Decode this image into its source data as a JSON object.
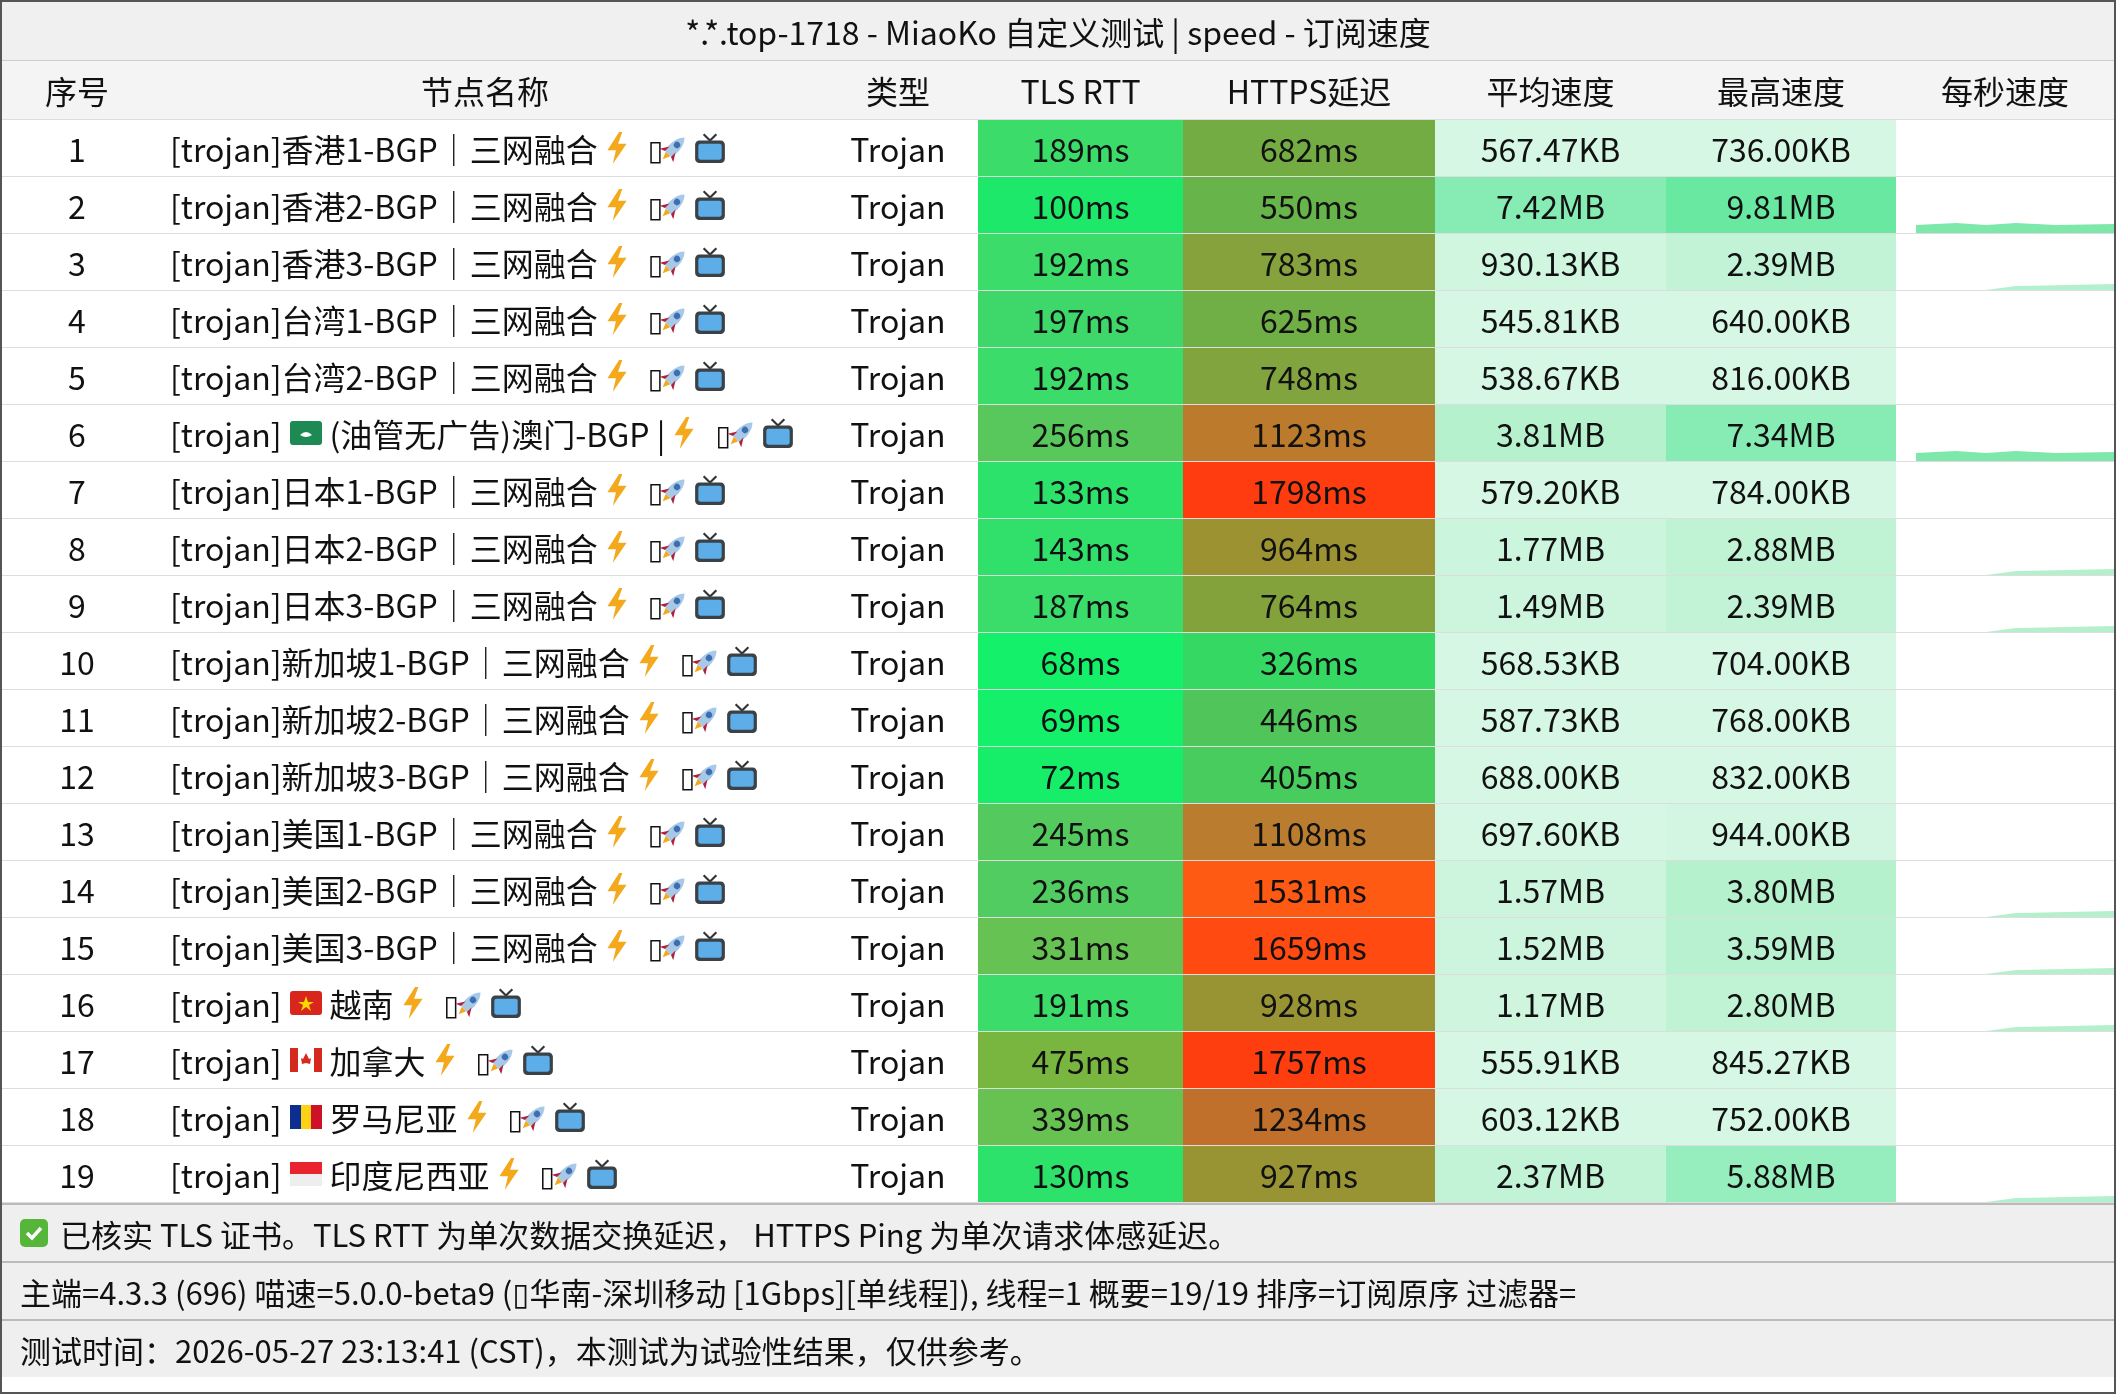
{
  "window": {
    "title": "*.*.top-1718 - MiaoKo 自定义测试 | speed - 订阅速度"
  },
  "columns": [
    "序号",
    "节点名称",
    "类型",
    "TLS RTT",
    "HTTPS延迟",
    "平均速度",
    "最高速度",
    "每秒速度"
  ],
  "rows": [
    {
      "index": "1",
      "name": [
        {
          "kind": "text",
          "text": "[trojan]香港1-BGP｜三网融合"
        },
        {
          "kind": "bolt"
        },
        {
          "kind": "text",
          "text": "▯"
        },
        {
          "kind": "rocket"
        },
        {
          "kind": "tv"
        }
      ],
      "type": "Trojan",
      "tls_rtt": {
        "text": "189ms",
        "color": "#3cdc6a"
      },
      "https_delay": {
        "text": "682ms",
        "color": "#74ac44"
      },
      "avg_speed": {
        "text": "567.47KB",
        "color": "#d6f7e4"
      },
      "max_speed": {
        "text": "736.00KB",
        "color": "#d6f7e4"
      }
    },
    {
      "index": "2",
      "name": [
        {
          "kind": "text",
          "text": "[trojan]香港2-BGP｜三网融合"
        },
        {
          "kind": "bolt"
        },
        {
          "kind": "text",
          "text": "▯"
        },
        {
          "kind": "rocket"
        },
        {
          "kind": "tv"
        }
      ],
      "type": "Trojan",
      "tls_rtt": {
        "text": "100ms",
        "color": "#1ee86a"
      },
      "https_delay": {
        "text": "550ms",
        "color": "#66b44a"
      },
      "avg_speed": {
        "text": "7.42MB",
        "color": "#86ecb4"
      },
      "max_speed": {
        "text": "9.81MB",
        "color": "#68e8a0"
      },
      "sparkline": {
        "kind": "strong"
      }
    },
    {
      "index": "3",
      "name": [
        {
          "kind": "text",
          "text": "[trojan]香港3-BGP｜三网融合"
        },
        {
          "kind": "bolt"
        },
        {
          "kind": "text",
          "text": "▯"
        },
        {
          "kind": "rocket"
        },
        {
          "kind": "tv"
        }
      ],
      "type": "Trojan",
      "tls_rtt": {
        "text": "192ms",
        "color": "#3cdc6a"
      },
      "https_delay": {
        "text": "783ms",
        "color": "#86a23c"
      },
      "avg_speed": {
        "text": "930.13KB",
        "color": "#d0f6e0"
      },
      "max_speed": {
        "text": "2.39MB",
        "color": "#c2f3d6"
      },
      "sparkline": {
        "kind": "faint"
      }
    },
    {
      "index": "4",
      "name": [
        {
          "kind": "text",
          "text": "[trojan]台湾1-BGP｜三网融合"
        },
        {
          "kind": "bolt"
        },
        {
          "kind": "text",
          "text": "▯"
        },
        {
          "kind": "rocket"
        },
        {
          "kind": "tv"
        }
      ],
      "type": "Trojan",
      "tls_rtt": {
        "text": "197ms",
        "color": "#3ed86a"
      },
      "https_delay": {
        "text": "625ms",
        "color": "#70ae46"
      },
      "avg_speed": {
        "text": "545.81KB",
        "color": "#d6f7e4"
      },
      "max_speed": {
        "text": "640.00KB",
        "color": "#d6f7e4"
      }
    },
    {
      "index": "5",
      "name": [
        {
          "kind": "text",
          "text": "[trojan]台湾2-BGP｜三网融合"
        },
        {
          "kind": "bolt"
        },
        {
          "kind": "text",
          "text": "▯"
        },
        {
          "kind": "rocket"
        },
        {
          "kind": "tv"
        }
      ],
      "type": "Trojan",
      "tls_rtt": {
        "text": "192ms",
        "color": "#3cdc6a"
      },
      "https_delay": {
        "text": "748ms",
        "color": "#82a43e"
      },
      "avg_speed": {
        "text": "538.67KB",
        "color": "#d6f7e4"
      },
      "max_speed": {
        "text": "816.00KB",
        "color": "#d6f7e4"
      }
    },
    {
      "index": "6",
      "name": [
        {
          "kind": "text",
          "text": "[trojan]"
        },
        {
          "kind": "flag_mo"
        },
        {
          "kind": "text",
          "text": "(油管无广告)澳门-BGP |"
        },
        {
          "kind": "bolt"
        },
        {
          "kind": "text",
          "text": "▯"
        },
        {
          "kind": "rocket"
        },
        {
          "kind": "tv"
        }
      ],
      "type": "Trojan",
      "tls_rtt": {
        "text": "256ms",
        "color": "#58c85c"
      },
      "https_delay": {
        "text": "1123ms",
        "color": "#bc7a2c"
      },
      "avg_speed": {
        "text": "3.81MB",
        "color": "#b6f1ce"
      },
      "max_speed": {
        "text": "7.34MB",
        "color": "#86ecb4"
      },
      "sparkline": {
        "kind": "strong"
      }
    },
    {
      "index": "7",
      "name": [
        {
          "kind": "text",
          "text": "[trojan]日本1-BGP｜三网融合"
        },
        {
          "kind": "bolt"
        },
        {
          "kind": "text",
          "text": "▯"
        },
        {
          "kind": "rocket"
        },
        {
          "kind": "tv"
        }
      ],
      "type": "Trojan",
      "tls_rtt": {
        "text": "133ms",
        "color": "#2ce26a"
      },
      "https_delay": {
        "text": "1798ms",
        "color": "#ff3c10"
      },
      "avg_speed": {
        "text": "579.20KB",
        "color": "#d6f7e4"
      },
      "max_speed": {
        "text": "784.00KB",
        "color": "#d6f7e4"
      }
    },
    {
      "index": "8",
      "name": [
        {
          "kind": "text",
          "text": "[trojan]日本2-BGP｜三网融合"
        },
        {
          "kind": "bolt"
        },
        {
          "kind": "text",
          "text": "▯"
        },
        {
          "kind": "rocket"
        },
        {
          "kind": "tv"
        }
      ],
      "type": "Trojan",
      "tls_rtt": {
        "text": "143ms",
        "color": "#30e06a"
      },
      "https_delay": {
        "text": "964ms",
        "color": "#9c9232"
      },
      "avg_speed": {
        "text": "1.77MB",
        "color": "#cbf5dc"
      },
      "max_speed": {
        "text": "2.88MB",
        "color": "#c0f3d4"
      },
      "sparkline": {
        "kind": "faint"
      }
    },
    {
      "index": "9",
      "name": [
        {
          "kind": "text",
          "text": "[trojan]日本3-BGP｜三网融合"
        },
        {
          "kind": "bolt"
        },
        {
          "kind": "text",
          "text": "▯"
        },
        {
          "kind": "rocket"
        },
        {
          "kind": "tv"
        }
      ],
      "type": "Trojan",
      "tls_rtt": {
        "text": "187ms",
        "color": "#3adc6a"
      },
      "https_delay": {
        "text": "764ms",
        "color": "#84a23c"
      },
      "avg_speed": {
        "text": "1.49MB",
        "color": "#cdf5de"
      },
      "max_speed": {
        "text": "2.39MB",
        "color": "#c2f3d6"
      },
      "sparkline": {
        "kind": "faint"
      }
    },
    {
      "index": "10",
      "name": [
        {
          "kind": "text",
          "text": "[trojan]新加坡1-BGP｜三网融合"
        },
        {
          "kind": "bolt"
        },
        {
          "kind": "text",
          "text": "▯"
        },
        {
          "kind": "rocket"
        },
        {
          "kind": "tv"
        }
      ],
      "type": "Trojan",
      "tls_rtt": {
        "text": "68ms",
        "color": "#14f06a"
      },
      "https_delay": {
        "text": "326ms",
        "color": "#36d864"
      },
      "avg_speed": {
        "text": "568.53KB",
        "color": "#d6f7e4"
      },
      "max_speed": {
        "text": "704.00KB",
        "color": "#d6f7e4"
      }
    },
    {
      "index": "11",
      "name": [
        {
          "kind": "text",
          "text": "[trojan]新加坡2-BGP｜三网融合"
        },
        {
          "kind": "bolt"
        },
        {
          "kind": "text",
          "text": "▯"
        },
        {
          "kind": "rocket"
        },
        {
          "kind": "tv"
        }
      ],
      "type": "Trojan",
      "tls_rtt": {
        "text": "69ms",
        "color": "#14f06a"
      },
      "https_delay": {
        "text": "446ms",
        "color": "#50c65a"
      },
      "avg_speed": {
        "text": "587.73KB",
        "color": "#d6f7e4"
      },
      "max_speed": {
        "text": "768.00KB",
        "color": "#d6f7e4"
      }
    },
    {
      "index": "12",
      "name": [
        {
          "kind": "text",
          "text": "[trojan]新加坡3-BGP｜三网融合"
        },
        {
          "kind": "bolt"
        },
        {
          "kind": "text",
          "text": "▯"
        },
        {
          "kind": "rocket"
        },
        {
          "kind": "tv"
        }
      ],
      "type": "Trojan",
      "tls_rtt": {
        "text": "72ms",
        "color": "#16ee6a"
      },
      "https_delay": {
        "text": "405ms",
        "color": "#48cc5e"
      },
      "avg_speed": {
        "text": "688.00KB",
        "color": "#d6f7e4"
      },
      "max_speed": {
        "text": "832.00KB",
        "color": "#d6f7e4"
      }
    },
    {
      "index": "13",
      "name": [
        {
          "kind": "text",
          "text": "[trojan]美国1-BGP｜三网融合"
        },
        {
          "kind": "bolt"
        },
        {
          "kind": "text",
          "text": "▯"
        },
        {
          "kind": "rocket"
        },
        {
          "kind": "tv"
        }
      ],
      "type": "Trojan",
      "tls_rtt": {
        "text": "245ms",
        "color": "#54ca5e"
      },
      "https_delay": {
        "text": "1108ms",
        "color": "#ba7c2e"
      },
      "avg_speed": {
        "text": "697.60KB",
        "color": "#d6f7e4"
      },
      "max_speed": {
        "text": "944.00KB",
        "color": "#d2f6e2"
      }
    },
    {
      "index": "14",
      "name": [
        {
          "kind": "text",
          "text": "[trojan]美国2-BGP｜三网融合"
        },
        {
          "kind": "bolt"
        },
        {
          "kind": "text",
          "text": "▯"
        },
        {
          "kind": "rocket"
        },
        {
          "kind": "tv"
        }
      ],
      "type": "Trojan",
      "tls_rtt": {
        "text": "236ms",
        "color": "#50cc60"
      },
      "https_delay": {
        "text": "1531ms",
        "color": "#ff5a14"
      },
      "avg_speed": {
        "text": "1.57MB",
        "color": "#cdf5de"
      },
      "max_speed": {
        "text": "3.80MB",
        "color": "#b6f1ce"
      },
      "sparkline": {
        "kind": "faint"
      }
    },
    {
      "index": "15",
      "name": [
        {
          "kind": "text",
          "text": "[trojan]美国3-BGP｜三网融合"
        },
        {
          "kind": "bolt"
        },
        {
          "kind": "text",
          "text": "▯"
        },
        {
          "kind": "rocket"
        },
        {
          "kind": "tv"
        }
      ],
      "type": "Trojan",
      "tls_rtt": {
        "text": "331ms",
        "color": "#66c252"
      },
      "https_delay": {
        "text": "1659ms",
        "color": "#ff4a12"
      },
      "avg_speed": {
        "text": "1.52MB",
        "color": "#cdf5de"
      },
      "max_speed": {
        "text": "3.59MB",
        "color": "#b8f1d0"
      },
      "sparkline": {
        "kind": "faint"
      }
    },
    {
      "index": "16",
      "name": [
        {
          "kind": "text",
          "text": "[trojan]"
        },
        {
          "kind": "flag_vn"
        },
        {
          "kind": "text",
          "text": "越南"
        },
        {
          "kind": "bolt"
        },
        {
          "kind": "text",
          "text": "▯"
        },
        {
          "kind": "rocket"
        },
        {
          "kind": "tv"
        }
      ],
      "type": "Trojan",
      "tls_rtt": {
        "text": "191ms",
        "color": "#3cdc6a"
      },
      "https_delay": {
        "text": "928ms",
        "color": "#989434"
      },
      "avg_speed": {
        "text": "1.17MB",
        "color": "#cff5df"
      },
      "max_speed": {
        "text": "2.80MB",
        "color": "#c0f3d4"
      },
      "sparkline": {
        "kind": "faint"
      }
    },
    {
      "index": "17",
      "name": [
        {
          "kind": "text",
          "text": "[trojan]"
        },
        {
          "kind": "flag_ca"
        },
        {
          "kind": "text",
          "text": "加拿大"
        },
        {
          "kind": "bolt"
        },
        {
          "kind": "text",
          "text": "▯"
        },
        {
          "kind": "rocket"
        },
        {
          "kind": "tv"
        }
      ],
      "type": "Trojan",
      "tls_rtt": {
        "text": "475ms",
        "color": "#78b640"
      },
      "https_delay": {
        "text": "1757ms",
        "color": "#ff3e10"
      },
      "avg_speed": {
        "text": "555.91KB",
        "color": "#d6f7e4"
      },
      "max_speed": {
        "text": "845.27KB",
        "color": "#d6f7e4"
      }
    },
    {
      "index": "18",
      "name": [
        {
          "kind": "text",
          "text": "[trojan]"
        },
        {
          "kind": "flag_ro"
        },
        {
          "kind": "text",
          "text": "罗马尼亚"
        },
        {
          "kind": "bolt"
        },
        {
          "kind": "text",
          "text": "▯"
        },
        {
          "kind": "rocket"
        },
        {
          "kind": "tv"
        }
      ],
      "type": "Trojan",
      "tls_rtt": {
        "text": "339ms",
        "color": "#68c252"
      },
      "https_delay": {
        "text": "1234ms",
        "color": "#c0702a"
      },
      "avg_speed": {
        "text": "603.12KB",
        "color": "#d6f7e4"
      },
      "max_speed": {
        "text": "752.00KB",
        "color": "#d6f7e4"
      }
    },
    {
      "index": "19",
      "name": [
        {
          "kind": "text",
          "text": "[trojan]"
        },
        {
          "kind": "flag_id"
        },
        {
          "kind": "text",
          "text": "印度尼西亚"
        },
        {
          "kind": "bolt"
        },
        {
          "kind": "text",
          "text": "▯"
        },
        {
          "kind": "rocket"
        },
        {
          "kind": "tv"
        }
      ],
      "type": "Trojan",
      "tls_rtt": {
        "text": "130ms",
        "color": "#2ce26a"
      },
      "https_delay": {
        "text": "927ms",
        "color": "#989434"
      },
      "avg_speed": {
        "text": "2.37MB",
        "color": "#c2f3d6"
      },
      "max_speed": {
        "text": "5.88MB",
        "color": "#96eebe"
      },
      "sparkline": {
        "kind": "faint"
      }
    }
  ],
  "footer": [
    {
      "kind": "verified",
      "text": "已核实 TLS 证书。TLS RTT 为单次数据交换延迟， HTTPS Ping 为单次请求体感延迟。"
    },
    {
      "kind": "plain",
      "text": "主端=4.3.3 (696) 喵速=5.0.0-beta9 (▯华南-深圳移动 [1Gbps][单线程]), 线程=1 概要=19/19 排序=订阅原序 过滤器="
    },
    {
      "kind": "plain",
      "text": "测试时间：2026-05-27 23:13:41 (CST)，本测试为试验性结果，仅供参考。"
    }
  ]
}
